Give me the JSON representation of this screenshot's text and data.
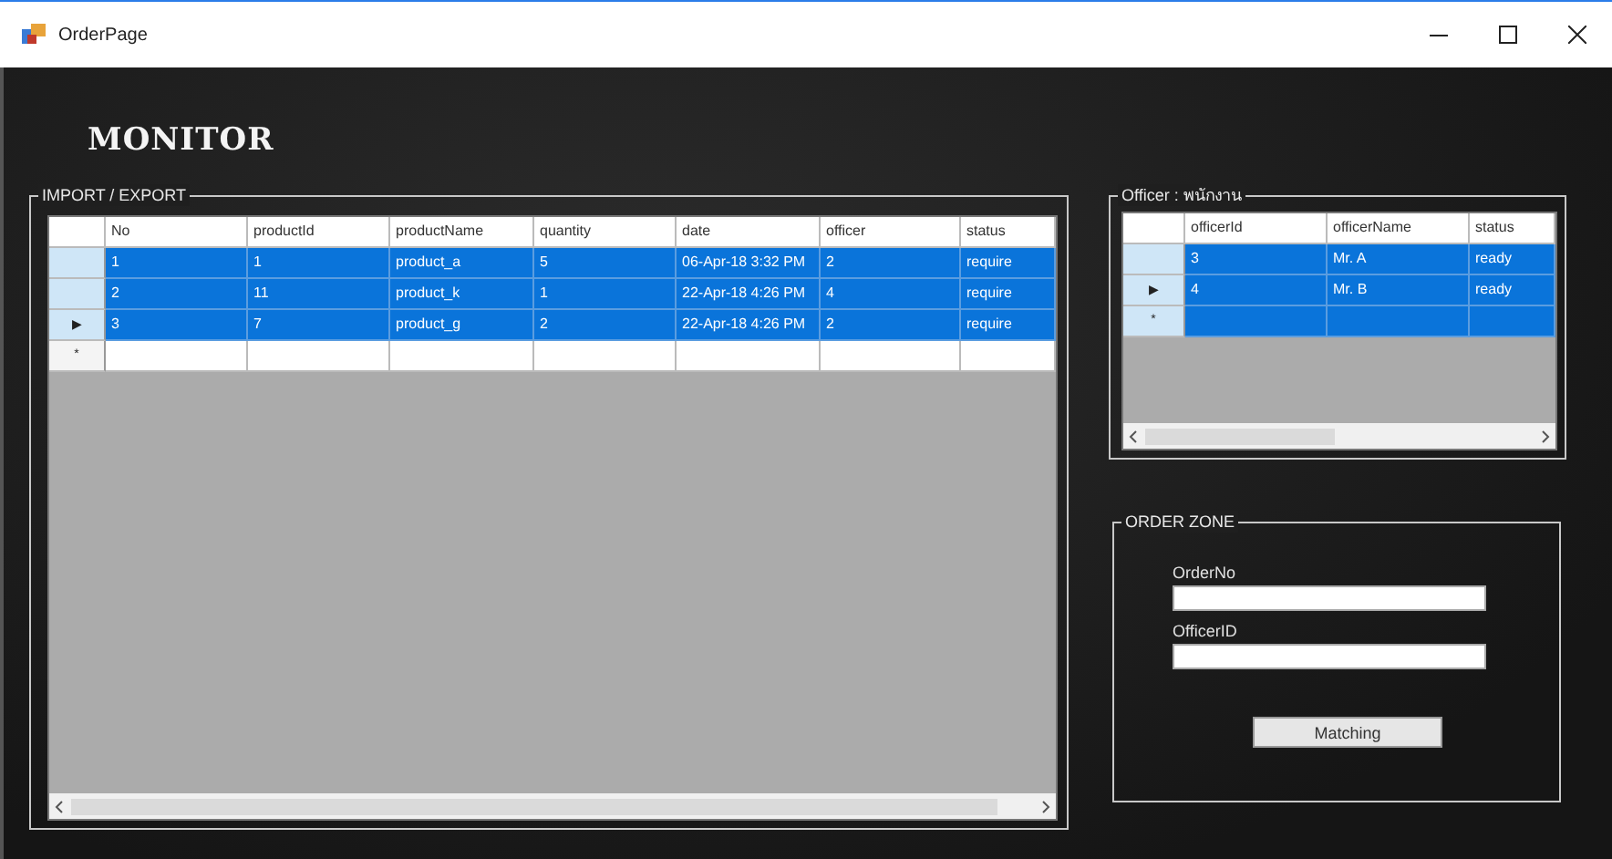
{
  "window": {
    "title": "OrderPage"
  },
  "heading": "MONITOR",
  "orders": {
    "title": "IMPORT / EXPORT",
    "columns": [
      "No",
      "productId",
      "productName",
      "quantity",
      "date",
      "officer",
      "status"
    ],
    "rows": [
      {
        "indicator": "",
        "selected": true,
        "cells": [
          "1",
          "1",
          "product_a",
          "5",
          "06-Apr-18 3:32 PM",
          "2",
          "require"
        ]
      },
      {
        "indicator": "",
        "selected": true,
        "cells": [
          "2",
          "11",
          "product_k",
          "1",
          "22-Apr-18 4:26 PM",
          "4",
          "require"
        ]
      },
      {
        "indicator": "▶",
        "selected": true,
        "cells": [
          "3",
          "7",
          "product_g",
          "2",
          "22-Apr-18 4:26 PM",
          "2",
          "require"
        ]
      }
    ],
    "new_row": {
      "indicator": "*",
      "selected": false
    }
  },
  "officers": {
    "title": "Officer : พนักงาน",
    "columns": [
      "officerId",
      "officerName",
      "status"
    ],
    "rows": [
      {
        "indicator": "",
        "selected": true,
        "cells": [
          "3",
          "Mr. A",
          "ready"
        ]
      },
      {
        "indicator": "▶",
        "selected": true,
        "cells": [
          "4",
          "Mr. B",
          "ready"
        ]
      }
    ],
    "new_row": {
      "indicator": "*",
      "selected": true
    }
  },
  "order_zone": {
    "title": "ORDER ZONE",
    "fields": [
      {
        "label": "OrderNo"
      },
      {
        "label": "OfficerID"
      }
    ],
    "button": "Matching"
  }
}
